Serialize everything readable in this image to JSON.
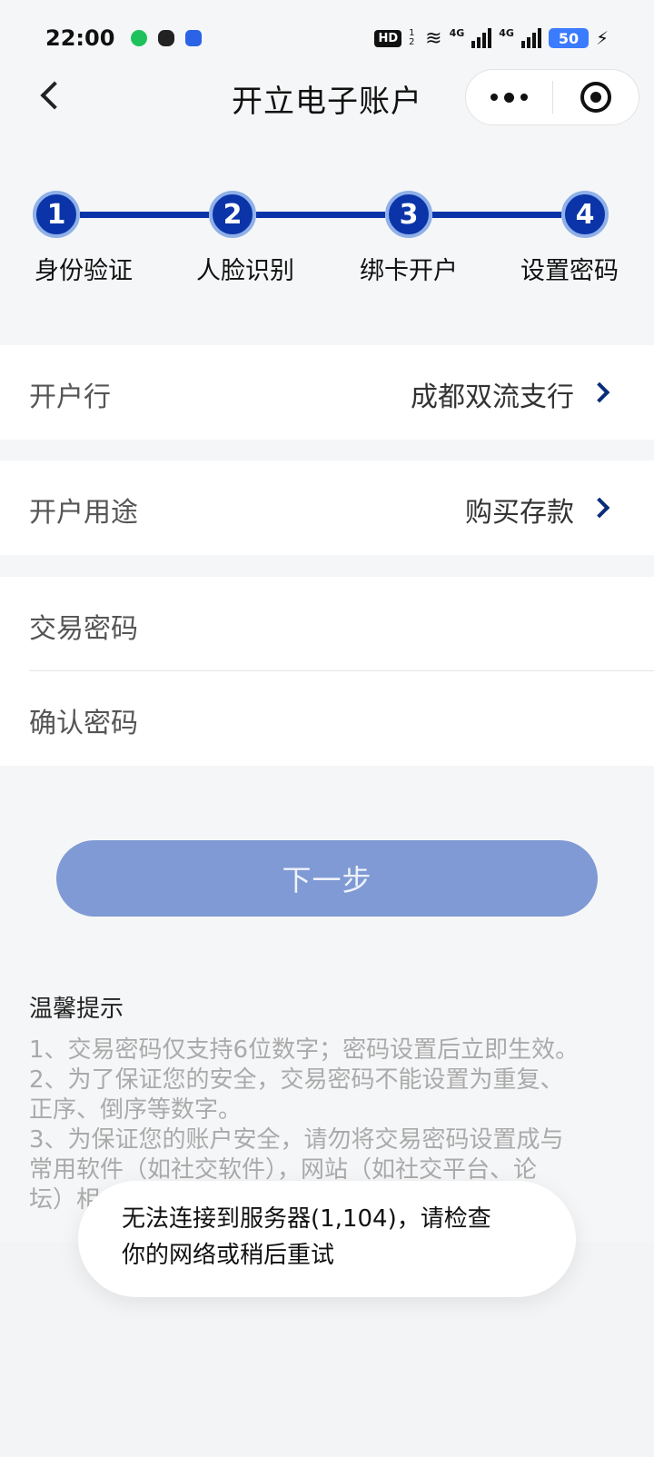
{
  "status_bar": {
    "time": "22:00",
    "network_badge": "HD",
    "network_sub": "1 2",
    "signal_1": "4G",
    "signal_2": "4G",
    "battery": "50",
    "app_icons": [
      "chat-bubble-icon",
      "wechat-icon",
      "baidu-icon"
    ]
  },
  "nav": {
    "title": "开立电子账户",
    "back_icon": "chevron-left-icon",
    "more_icon": "more-dots-icon",
    "close_icon": "target-close-icon"
  },
  "stepper": {
    "steps": [
      {
        "number": "1",
        "label": "身份验证"
      },
      {
        "number": "2",
        "label": "人脸识别"
      },
      {
        "number": "3",
        "label": "绑卡开户"
      },
      {
        "number": "4",
        "label": "设置密码"
      }
    ],
    "active_color": "#0a34a8"
  },
  "form": {
    "branch": {
      "label": "开户行",
      "value": "成都双流支行"
    },
    "purpose": {
      "label": "开户用途",
      "value": "购买存款"
    },
    "trade_password": {
      "label": "交易密码"
    },
    "confirm_password": {
      "label": "确认密码"
    }
  },
  "next_button": {
    "label": "下一步",
    "color": "#7f9ad4"
  },
  "tips": {
    "title": "温馨提示",
    "lines": [
      "1、交易密码仅支持6位数字；密码设置后立即生效。",
      "2、为了保证您的安全，交易密码不能设置为重复、",
      "正序、倒序等数字。",
      "3、为保证您的账户安全，请勿将交易密码设置成与",
      "常用软件（如社交软件），网站（如社交平台、论",
      "坛）相"
    ]
  },
  "toast": {
    "line1": "无法连接到服务器(1,104)，请检查",
    "line2": "你的网络或稍后重试"
  }
}
